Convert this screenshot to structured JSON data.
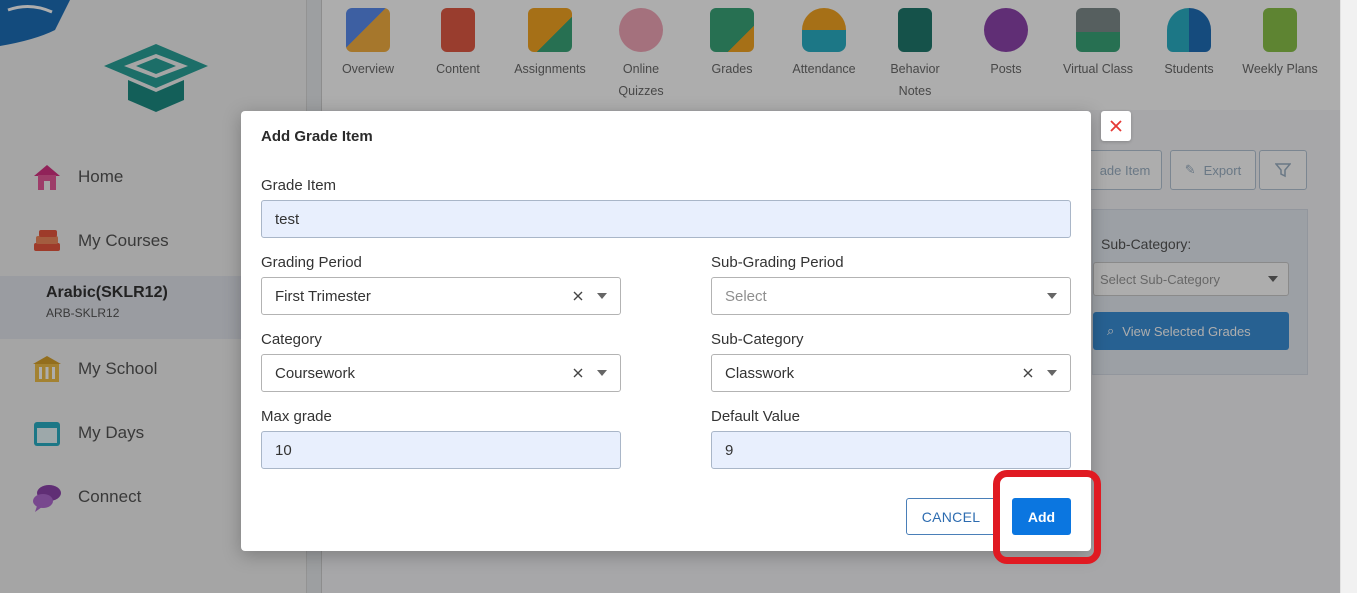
{
  "sidebar": {
    "items": [
      {
        "label": "Home",
        "icon": "home-icon"
      },
      {
        "label": "My Courses",
        "icon": "books-icon"
      },
      {
        "label": "My School",
        "icon": "school-icon"
      },
      {
        "label": "My Days",
        "icon": "calendar-icon"
      },
      {
        "label": "Connect",
        "icon": "chat-icon"
      }
    ],
    "course": {
      "name": "Arabic(SKLR12)",
      "code": "ARB-SKLR12"
    }
  },
  "topnav": {
    "items": [
      {
        "label": "Overview",
        "icon": "overview-icon"
      },
      {
        "label": "Content",
        "icon": "content-icon"
      },
      {
        "label": "Assignments",
        "icon": "assignments-icon"
      },
      {
        "label": "Online Quizzes",
        "icon": "quiz-icon"
      },
      {
        "label": "Grades",
        "icon": "grades-icon"
      },
      {
        "label": "Attendance",
        "icon": "attendance-icon"
      },
      {
        "label": "Behavior Notes",
        "icon": "behavior-icon"
      },
      {
        "label": "Posts",
        "icon": "posts-icon"
      },
      {
        "label": "Virtual Class",
        "icon": "virtual-class-icon"
      },
      {
        "label": "Students",
        "icon": "students-icon"
      },
      {
        "label": "Weekly Plans",
        "icon": "weekly-plans-icon"
      }
    ]
  },
  "background": {
    "add_grade_item_partial": "ade Item",
    "export_label": "Export",
    "sub_category_label": "Sub-Category:",
    "sub_category_placeholder": "Select Sub-Category",
    "view_selected_label": "View Selected Grades"
  },
  "modal": {
    "title": "Add Grade Item",
    "grade_item": {
      "label": "Grade Item",
      "value": "test"
    },
    "grading_period": {
      "label": "Grading Period",
      "value": "First Trimester"
    },
    "sub_grading_period": {
      "label": "Sub-Grading Period",
      "placeholder": "Select"
    },
    "category": {
      "label": "Category",
      "value": "Coursework"
    },
    "sub_category": {
      "label": "Sub-Category",
      "value": "Classwork"
    },
    "max_grade": {
      "label": "Max grade",
      "value": "10"
    },
    "default_value": {
      "label": "Default Value",
      "value": "9"
    },
    "cancel_label": "CANCEL",
    "add_label": "Add"
  },
  "colors": {
    "primary": "#0b76e0",
    "highlight": "#e01a22",
    "close": "#e53935"
  }
}
